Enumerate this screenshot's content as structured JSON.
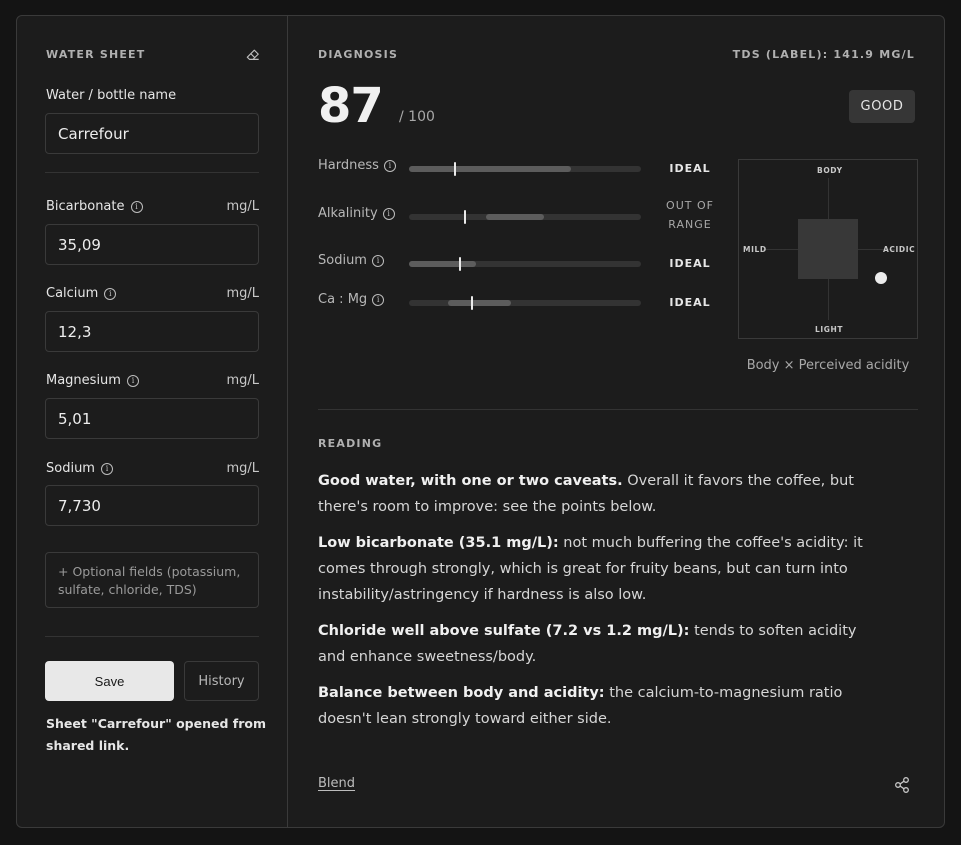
{
  "water_sheet": {
    "title": "WATER SHEET",
    "bottle_label": "Water / bottle name",
    "bottle_value": "Carrefour",
    "fields": [
      {
        "label": "Bicarbonate",
        "unit": "mg/L",
        "value": "35,09"
      },
      {
        "label": "Calcium",
        "unit": "mg/L",
        "value": "12,3"
      },
      {
        "label": "Magnesium",
        "unit": "mg/L",
        "value": "5,01"
      },
      {
        "label": "Sodium",
        "unit": "mg/L",
        "value": "7,730"
      }
    ],
    "optional_fields": "+ Optional fields (potassium, sulfate, chloride, TDS)",
    "save_label": "Save",
    "history_label": "History",
    "status": "Sheet \"Carrefour\" opened from shared link."
  },
  "diagnosis": {
    "title": "DIAGNOSIS",
    "tds_label": "TDS (LABEL): 141.9 MG/L",
    "score": "87",
    "score_max": "/ 100",
    "badge": "GOOD",
    "metrics": [
      {
        "label": "Hardness",
        "status": "IDEAL",
        "fill_start": 0.0,
        "fill_end": 0.7,
        "marker": 0.2
      },
      {
        "label": "Alkalinity",
        "status": "OUT OF RANGE",
        "fill_start": 0.33,
        "fill_end": 0.58,
        "marker": 0.24
      },
      {
        "label": "Sodium",
        "status": "IDEAL",
        "fill_start": 0.0,
        "fill_end": 0.29,
        "marker": 0.22
      },
      {
        "label": "Ca : Mg",
        "status": "IDEAL",
        "fill_start": 0.17,
        "fill_end": 0.44,
        "marker": 0.27
      }
    ],
    "matrix": {
      "top": "BODY",
      "bottom": "LIGHT",
      "left": "MILD",
      "right": "ACIDIC",
      "caption": "Body × Perceived acidity"
    }
  },
  "reading": {
    "title": "READING",
    "paragraphs": [
      {
        "bold": "Good water, with one or two caveats.",
        "text": " Overall it favors the coffee, but there's room to improve: see the points below."
      },
      {
        "bold": "Low bicarbonate (35.1 mg/L):",
        "text": " not much buffering the coffee's acidity: it comes through strongly, which is great for fruity beans, but can turn into instability/astringency if hardness is also low."
      },
      {
        "bold": "Chloride well above sulfate (7.2 vs 1.2 mg/L):",
        "text": " tends to soften acidity and enhance sweetness/body."
      },
      {
        "bold": "Balance between body and acidity:",
        "text": " the calcium-to-magnesium ratio doesn't lean strongly toward either side."
      }
    ]
  },
  "footer": {
    "blend_label": "Blend"
  },
  "icons": {
    "eraser": "eraser-icon",
    "info": "info-icon",
    "share": "share-icon"
  }
}
